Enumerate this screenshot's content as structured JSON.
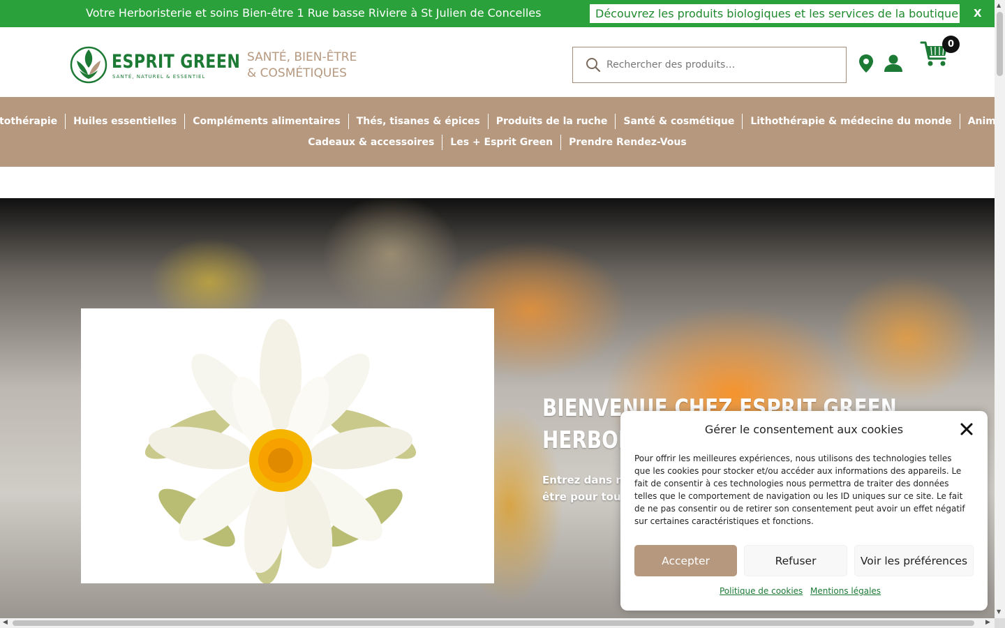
{
  "topbar": {
    "message": "Votre Herboristerie et soins Bien-être 1 Rue basse Riviere à St Julien de Concelles",
    "cta": "Découvrez les produits biologiques et les services de la boutique",
    "close": "X",
    "color": "#2aa13a"
  },
  "header": {
    "logo_word": "ESPRIT GREEN",
    "logo_tagline": "SANTÉ, NATUREL & ESSENTIEL",
    "slogan_line1": "SANTÉ, BIEN-ÊTRE",
    "slogan_line2": "& COSMÉTIQUES",
    "search_placeholder": "Rechercher des produits…",
    "cart_count": "0",
    "icons": [
      "search-icon",
      "map-pin-icon",
      "user-icon",
      "cart-icon"
    ],
    "brand_color": "#1c7a35",
    "accent_color": "#b6987f"
  },
  "nav": {
    "row1": [
      "Phytothérapie",
      "Huiles essentielles",
      "Compléments alimentaires",
      "Thés, tisanes & épices",
      "Produits de la ruche",
      "Santé & cosmétique",
      "Lithothérapie & médecine du monde",
      "Animaux"
    ],
    "row2": [
      "Cadeaux & accessoires",
      "Les + Esprit Green",
      "Prendre Rendez-Vous"
    ]
  },
  "hero": {
    "title_line1": "BIENVENUE CHEZ ESPRIT GREEN",
    "title_line2": "HERBORISTERIE",
    "subtitle_line1": "Entrez dans notre univers",
    "subtitle_line2": "être pour tous"
  },
  "cookie": {
    "title": "Gérer le consentement aux cookies",
    "body": "Pour offrir les meilleures expériences, nous utilisons des technologies telles que les cookies pour stocker et/ou accéder aux informations des appareils. Le fait de consentir à ces technologies nous permettra de traiter des données telles que le comportement de navigation ou les ID uniques sur ce site. Le fait de ne pas consentir ou de retirer son consentement peut avoir un effet négatif sur certaines caractéristiques et fonctions.",
    "accept": "Accepter",
    "deny": "Refuser",
    "prefs": "Voir les préférences",
    "link_policy": "Politique de cookies",
    "link_legal": "Mentions légales"
  }
}
